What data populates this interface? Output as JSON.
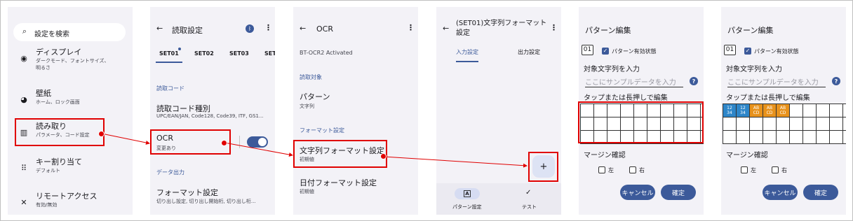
{
  "panel1": {
    "search_placeholder": "設定を検索",
    "items": [
      {
        "title": "ディスプレイ",
        "sub": "ダークモード、フォントサイズ、\n明るさ",
        "icon": "display-icon"
      },
      {
        "title": "壁紙",
        "sub": "ホーム、ロック画面",
        "icon": "palette-icon"
      },
      {
        "title": "読み取り",
        "sub": "パラメータ、コード設定",
        "icon": "barcode-scan-icon"
      },
      {
        "title": "キー割り当て",
        "sub": "デフォルト",
        "icon": "keypad-icon"
      },
      {
        "title": "リモートアクセス",
        "sub": "有効/無効",
        "icon": "tools-icon"
      }
    ]
  },
  "panel2": {
    "title": "読取設定",
    "tabs": [
      "SET01",
      "SET02",
      "SET03",
      "SET"
    ],
    "section_code": "読取コード",
    "code_type_title": "読取コード種別",
    "code_type_sub": "UPC/EAN/JAN, Code128, Code39, ITF, GS1...",
    "ocr_title": "OCR",
    "ocr_sub": "変更あり",
    "ocr_toggle": true,
    "section_output": "データ出力",
    "format_title": "フォーマット設定",
    "format_sub": "切り出し設定, 切り出し開始桁, 切り出し桁..."
  },
  "panel3": {
    "title": "OCR",
    "activated": "BT-OCR2 Activated",
    "section_target": "読取対象",
    "pattern_title": "パターン",
    "pattern_sub": "文字列",
    "section_format": "フォーマット設定",
    "string_format_title": "文字列フォーマット設定",
    "string_format_sub": "初期値",
    "date_format_title": "日付フォーマット設定",
    "date_format_sub": "初期値"
  },
  "panel4": {
    "title": "(SET01)文字列フォーマット\n設定",
    "tabs": [
      "入力設定",
      "出力設定"
    ],
    "fab_label": "+",
    "nav_items": [
      {
        "label": "パターン設定",
        "icon_text": "A"
      },
      {
        "label": "テスト",
        "icon_text": "✓"
      }
    ]
  },
  "panel5": {
    "title": "パターン編集",
    "index": "01",
    "pattern_enable_label": "パターン有効状態",
    "target_label": "対象文字列を入力",
    "input_placeholder": "ここにサンプルデータを入力",
    "grid_hint": "タップまたは長押しで編集",
    "grid_cells": [],
    "margin_label": "マージン確認",
    "left_label": "左",
    "right_label": "右",
    "cancel_label": "キャンセル",
    "ok_label": "確定"
  },
  "panel6": {
    "title": "パターン編集",
    "index": "01",
    "pattern_enable_label": "パターン有効状態",
    "target_label": "対象文字列を入力",
    "input_placeholder": "ここにサンプルデータを入力",
    "grid_hint": "タップまたは長押しで編集",
    "grid_cells": [
      {
        "text": "12\n34",
        "color": "#2e86c9"
      },
      {
        "text": "12\n34",
        "color": "#2e86c9"
      },
      {
        "text": "AB\nCD",
        "color": "#e8921c"
      },
      {
        "text": "AB\nCD",
        "color": "#e8921c"
      },
      {
        "text": "AB\nCD",
        "color": "#e8921c"
      }
    ],
    "margin_label": "マージン確認",
    "left_label": "左",
    "right_label": "右",
    "cancel_label": "キャンセル",
    "ok_label": "確定"
  },
  "colors": {
    "highlight": "#e00000",
    "accent": "#3c5a9a",
    "panel_bg": "#f3f2f7"
  }
}
